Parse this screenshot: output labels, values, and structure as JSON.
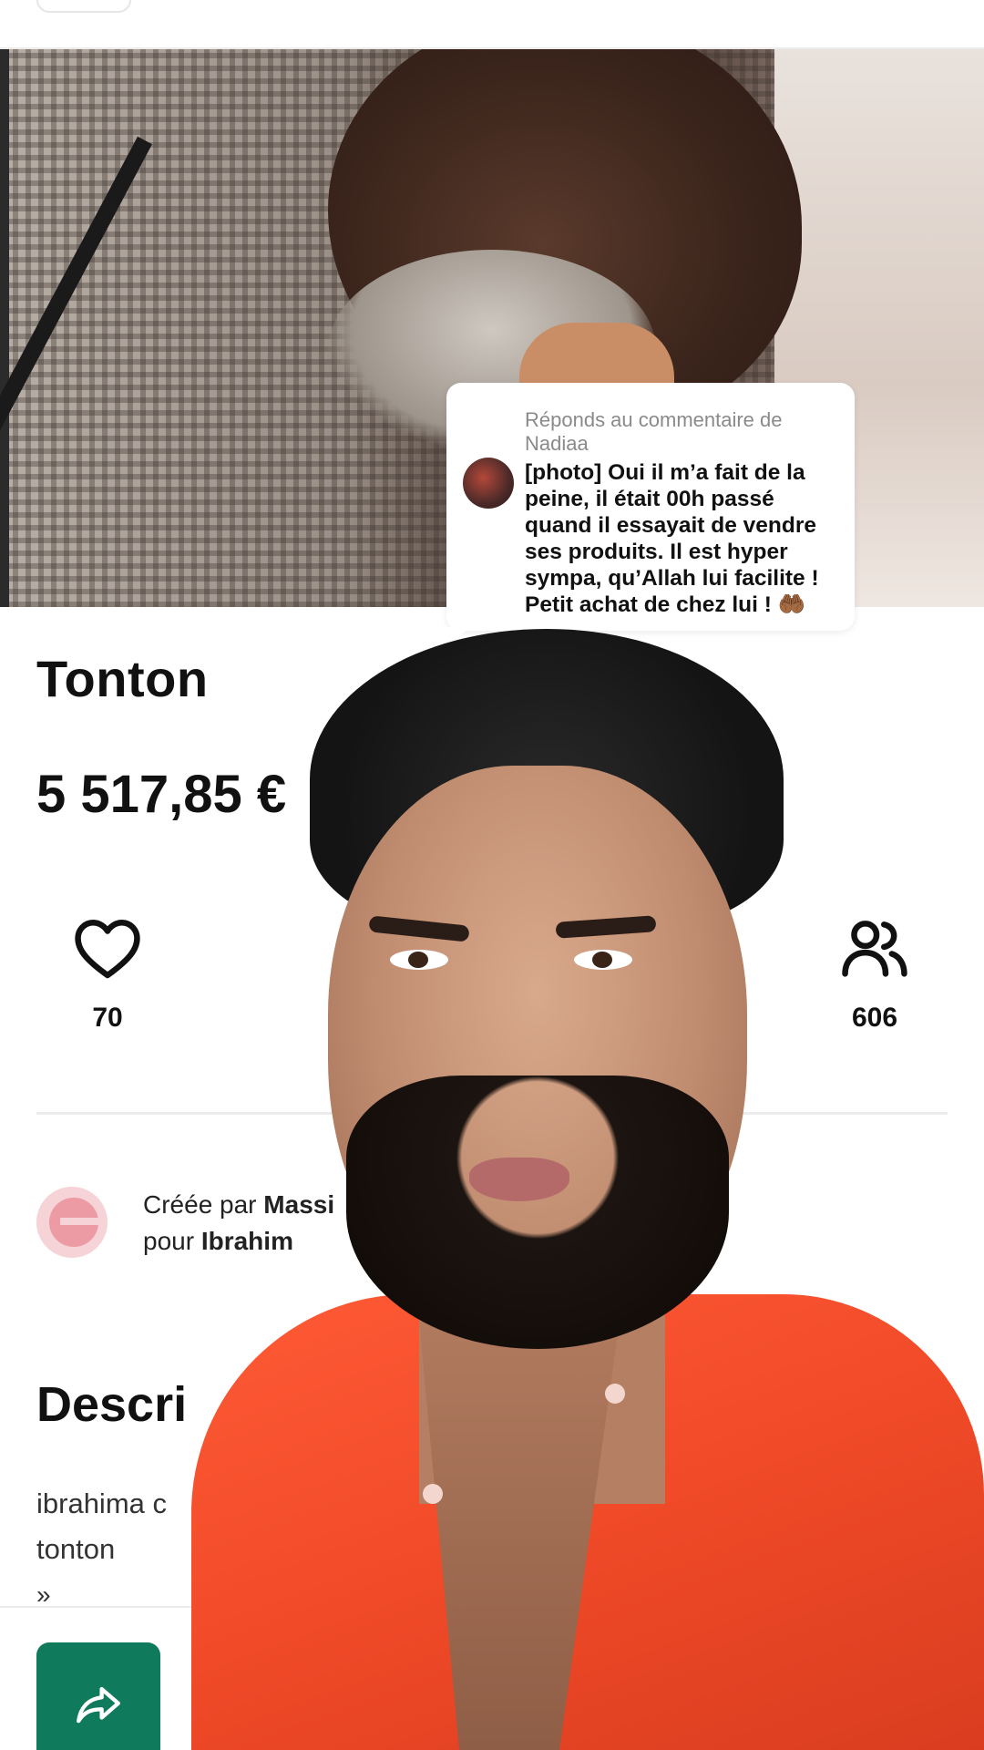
{
  "reply": {
    "header": "Réponds au commentaire de Nadiaa",
    "text": "[photo] Oui il m’a fait de la peine, il était 00h passé quand il essayait de vendre ses produits. Il est hyper sympa, qu’Allah lui facilite ! Petit achat de chez lui ! 🤲🏾"
  },
  "pot": {
    "title": "Tonton",
    "amount": "5 517,85 €"
  },
  "stats": {
    "likes": {
      "icon": "heart-icon",
      "count": "70"
    },
    "contributors": {
      "icon": "users-icon",
      "count": "606"
    }
  },
  "creator": {
    "logo_icon": "organizer-logo-icon",
    "line1_prefix": "Créée par",
    "line1_name": "Massi",
    "line2_prefix": "pour",
    "line2_name": "Ibrahim"
  },
  "description": {
    "title": "Descri",
    "line1": "ibrahima c",
    "line2": "tonton",
    "more": "»"
  },
  "share": {
    "icon": "share-arrow-icon"
  },
  "colors": {
    "share_button": "#0f7a5c",
    "shirt": "#f04a28",
    "logo_pink": "#ec9aa3"
  }
}
